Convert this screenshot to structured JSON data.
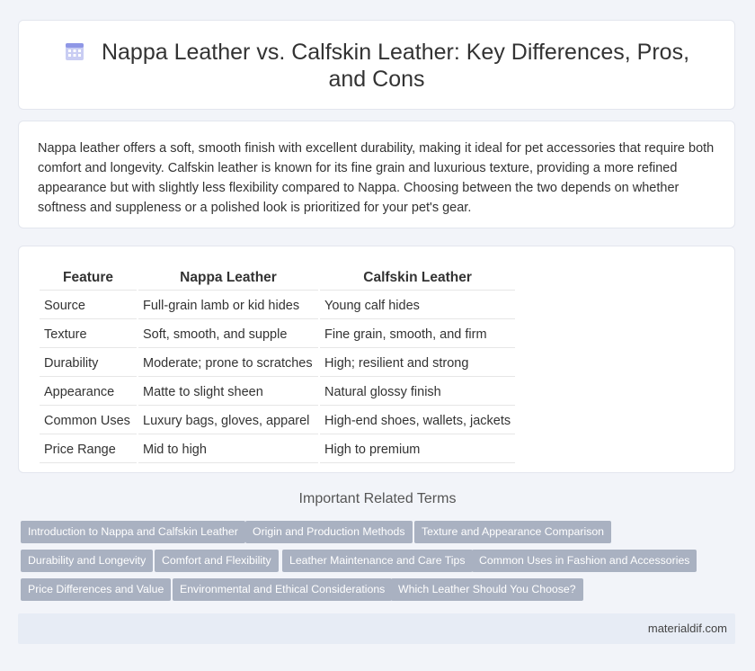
{
  "header": {
    "title": "Nappa Leather vs. Calfskin Leather: Key Differences, Pros, and Cons",
    "icon": "calendar-grid-icon"
  },
  "intro": {
    "text": "Nappa leather offers a soft, smooth finish with excellent durability, making it ideal for pet accessories that require both comfort and longevity. Calfskin leather is known for its fine grain and luxurious texture, providing a more refined appearance but with slightly less flexibility compared to Nappa. Choosing between the two depends on whether softness and suppleness or a polished look is prioritized for your pet's gear."
  },
  "table": {
    "headers": [
      "Feature",
      "Nappa Leather",
      "Calfskin Leather"
    ],
    "rows": [
      [
        "Source",
        "Full-grain lamb or kid hides",
        "Young calf hides"
      ],
      [
        "Texture",
        "Soft, smooth, and supple",
        "Fine grain, smooth, and firm"
      ],
      [
        "Durability",
        "Moderate; prone to scratches",
        "High; resilient and strong"
      ],
      [
        "Appearance",
        "Matte to slight sheen",
        "Natural glossy finish"
      ],
      [
        "Common Uses",
        "Luxury bags, gloves, apparel",
        "High-end shoes, wallets, jackets"
      ],
      [
        "Price Range",
        "Mid to high",
        "High to premium"
      ]
    ]
  },
  "related": {
    "title": "Important Related Terms",
    "tags": [
      "Introduction to Nappa and Calfskin Leather",
      "Origin and Production Methods",
      "Texture and Appearance Comparison",
      "Durability and Longevity",
      "Comfort and Flexibility",
      "Leather Maintenance and Care Tips",
      "Common Uses in Fashion and Accessories",
      "Price Differences and Value",
      "Environmental and Ethical Considerations",
      "Which Leather Should You Choose?"
    ]
  },
  "footer": {
    "text": "materialdif.com"
  },
  "colors": {
    "tag_bg": "#a9b1c1",
    "page_bg": "#f2f4f9",
    "footer_bg": "#e7ecf5"
  }
}
